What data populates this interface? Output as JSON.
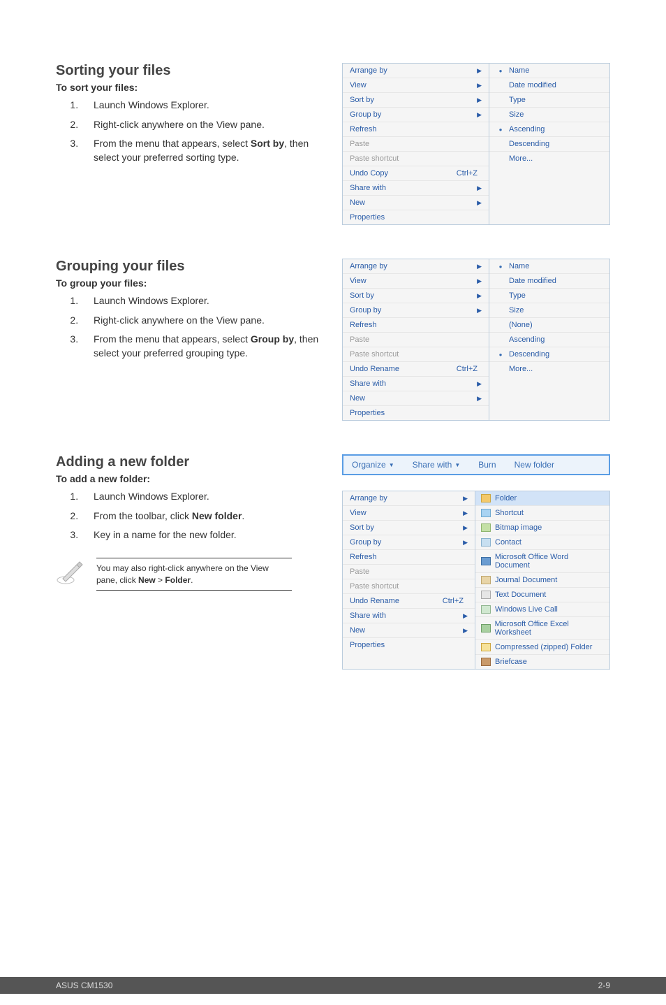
{
  "footer": {
    "left": "ASUS CM1530",
    "right": "2-9"
  },
  "sorting": {
    "heading": "Sorting your files",
    "subhead": "To sort your files:",
    "steps": [
      "Launch Windows Explorer.",
      "Right-click anywhere on the View pane.",
      "From the menu that appears, select <b>Sort by</b>, then select your preferred sorting type."
    ],
    "menu": {
      "items": [
        {
          "label": "Arrange by",
          "arrow": true
        },
        {
          "label": "View",
          "arrow": true
        },
        {
          "label": "Sort by",
          "arrow": true
        },
        {
          "label": "Group by",
          "arrow": true
        },
        {
          "label": "Refresh"
        },
        {
          "label": "Paste",
          "disabled": true
        },
        {
          "label": "Paste shortcut",
          "disabled": true
        },
        {
          "label": "Undo Copy",
          "shortcut": "Ctrl+Z"
        },
        {
          "label": "Share with",
          "arrow": true
        },
        {
          "label": "New",
          "arrow": true
        },
        {
          "label": "Properties"
        }
      ],
      "submenu": [
        {
          "label": "Name",
          "bullet": true
        },
        {
          "label": "Date modified"
        },
        {
          "label": "Type"
        },
        {
          "label": "Size"
        },
        {
          "label": "Ascending",
          "bullet": true
        },
        {
          "label": "Descending"
        },
        {
          "label": "More..."
        }
      ]
    }
  },
  "grouping": {
    "heading": "Grouping your files",
    "subhead": "To group your files:",
    "steps": [
      "Launch Windows Explorer.",
      "Right-click anywhere on the View pane.",
      "From the menu that appears, select <b>Group by</b>, then select your preferred grouping type."
    ],
    "menu": {
      "items": [
        {
          "label": "Arrange by",
          "arrow": true
        },
        {
          "label": "View",
          "arrow": true
        },
        {
          "label": "Sort by",
          "arrow": true
        },
        {
          "label": "Group by",
          "arrow": true
        },
        {
          "label": "Refresh"
        },
        {
          "label": "Paste",
          "disabled": true
        },
        {
          "label": "Paste shortcut",
          "disabled": true
        },
        {
          "label": "Undo Rename",
          "shortcut": "Ctrl+Z"
        },
        {
          "label": "Share with",
          "arrow": true
        },
        {
          "label": "New",
          "arrow": true
        },
        {
          "label": "Properties"
        }
      ],
      "submenu": [
        {
          "label": "Name",
          "bullet": true
        },
        {
          "label": "Date modified"
        },
        {
          "label": "Type"
        },
        {
          "label": "Size"
        },
        {
          "label": "(None)"
        },
        {
          "label": "Ascending"
        },
        {
          "label": "Descending",
          "bullet": true
        },
        {
          "label": "More..."
        }
      ]
    }
  },
  "adding": {
    "heading": "Adding a new folder",
    "subhead": "To add a new folder:",
    "steps": [
      "Launch Windows Explorer.",
      "From the toolbar, click <b>New folder</b>.",
      "Key in a name for the new folder."
    ],
    "tip": "You may also right-click anywhere on the View pane, click <b>New</b> > <b>Folder</b>.",
    "toolbar": {
      "organize": "Organize",
      "sharewith": "Share with",
      "burn": "Burn",
      "newfolder": "New folder"
    },
    "menu": {
      "items": [
        {
          "label": "Arrange by",
          "arrow": true
        },
        {
          "label": "View",
          "arrow": true
        },
        {
          "label": "Sort by",
          "arrow": true
        },
        {
          "label": "Group by",
          "arrow": true
        },
        {
          "label": "Refresh"
        },
        {
          "label": "Paste",
          "disabled": true
        },
        {
          "label": "Paste shortcut",
          "disabled": true
        },
        {
          "label": "Undo Rename",
          "shortcut": "Ctrl+Z"
        },
        {
          "label": "Share with",
          "arrow": true
        },
        {
          "label": "New",
          "arrow": true,
          "sel": true
        },
        {
          "label": "Properties"
        }
      ],
      "submenu": [
        {
          "label": "Folder",
          "icon": "ic-folder",
          "sel": true
        },
        {
          "label": "Shortcut",
          "icon": "ic-shortcut"
        },
        {
          "label": "Bitmap image",
          "icon": "ic-bmp"
        },
        {
          "label": "Contact",
          "icon": "ic-contact"
        },
        {
          "label": "Microsoft Office Word Document",
          "icon": "ic-word"
        },
        {
          "label": "Journal Document",
          "icon": "ic-journal"
        },
        {
          "label": "Text Document",
          "icon": "ic-text"
        },
        {
          "label": "Windows Live Call",
          "icon": "ic-call"
        },
        {
          "label": "Microsoft Office Excel Worksheet",
          "icon": "ic-excel"
        },
        {
          "label": "Compressed (zipped) Folder",
          "icon": "ic-zip"
        },
        {
          "label": "Briefcase",
          "icon": "ic-brief"
        }
      ]
    }
  }
}
